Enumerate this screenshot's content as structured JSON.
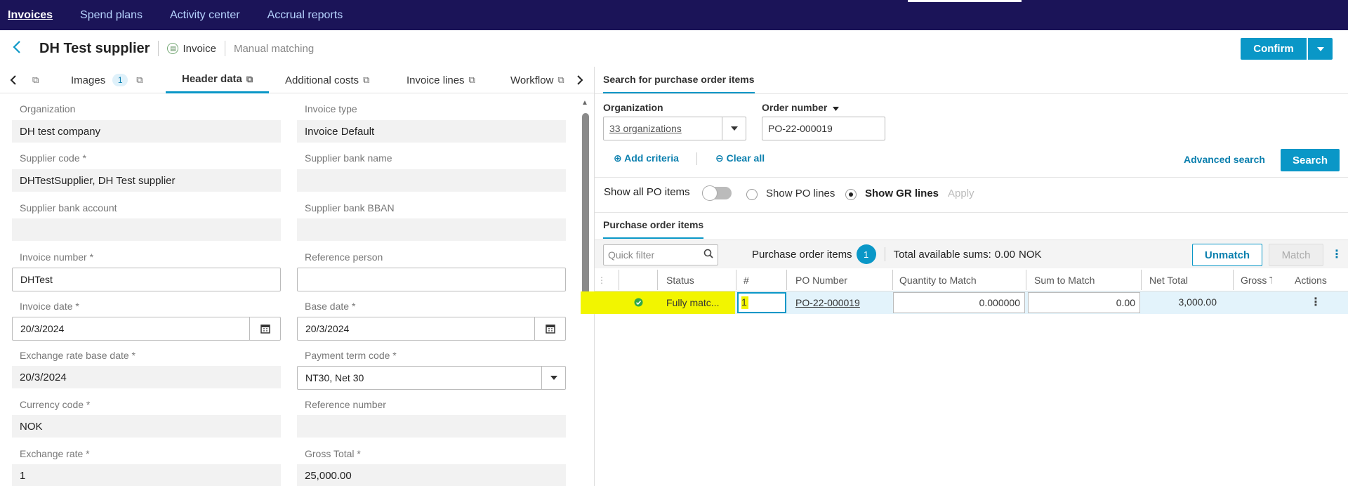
{
  "nav": {
    "items": [
      "Invoices",
      "Spend plans",
      "Activity center",
      "Accrual reports"
    ]
  },
  "header": {
    "back_icon": "chevron-left-icon",
    "title": "DH Test supplier",
    "doc_type": "Invoice",
    "mode": "Manual matching",
    "confirm_label": "Confirm"
  },
  "tabs": {
    "images": "Images",
    "images_count": "1",
    "header_data": "Header data",
    "additional_costs": "Additional costs",
    "invoice_lines": "Invoice lines",
    "workflow": "Workflow"
  },
  "form": {
    "organization_label": "Organization",
    "organization": "DH test company",
    "invoice_type_label": "Invoice type",
    "invoice_type": "Invoice Default",
    "supplier_code_label": "Supplier code *",
    "supplier_code": "DHTestSupplier, DH Test supplier",
    "supplier_bank_name_label": "Supplier bank name",
    "supplier_bank_name": "",
    "supplier_bank_account_label": "Supplier bank account",
    "supplier_bank_account": "",
    "supplier_bank_bban_label": "Supplier bank BBAN",
    "supplier_bank_bban": "",
    "invoice_number_label": "Invoice number *",
    "invoice_number": "DHTest",
    "reference_person_label": "Reference person",
    "reference_person": "",
    "invoice_date_label": "Invoice date *",
    "invoice_date": "20/3/2024",
    "base_date_label": "Base date *",
    "base_date": "20/3/2024",
    "exchange_rate_base_date_label": "Exchange rate base date *",
    "exchange_rate_base_date": "20/3/2024",
    "payment_term_code_label": "Payment term code *",
    "payment_term_code": "NT30, Net 30",
    "currency_code_label": "Currency code *",
    "currency_code": "NOK",
    "reference_number_label": "Reference number",
    "reference_number": "",
    "exchange_rate_label": "Exchange rate *",
    "exchange_rate": "1",
    "gross_total_label": "Gross Total *",
    "gross_total": "25,000.00"
  },
  "search": {
    "tab": "Search for purchase order items",
    "organization_label": "Organization",
    "organization_value": "33 organizations",
    "order_number_label": "Order number",
    "order_number_value": "PO-22-000019",
    "add_criteria": "Add criteria",
    "clear_all": "Clear all",
    "advanced_search": "Advanced search",
    "search_button": "Search",
    "show_all_po_items": "Show all PO items",
    "show_po_lines": "Show PO lines",
    "show_gr_lines": "Show GR lines",
    "apply": "Apply"
  },
  "po_items": {
    "tab": "Purchase order items",
    "quick_filter_placeholder": "Quick filter",
    "label": "Purchase order items",
    "count": "1",
    "total_label": "Total available sums:",
    "total_value": "0.00",
    "total_currency": "NOK",
    "unmatch": "Unmatch",
    "match": "Match",
    "columns": {
      "status": "Status",
      "num": "#",
      "po_number": "PO Number",
      "qty_to_match": "Quantity to Match",
      "sum_to_match": "Sum to Match",
      "net_total": "Net Total",
      "gross_total": "Gross To",
      "actions": "Actions"
    },
    "rows": [
      {
        "status": "Fully matc...",
        "num": "1",
        "po_number": "PO-22-000019",
        "qty_to_match": "0.000000",
        "sum_to_match": "0.00",
        "net_total": "3,000.00",
        "gross_total": ""
      }
    ]
  },
  "colors": {
    "nav_bg": "#1b1458",
    "accent": "#0a97c7",
    "highlight": "#f2f500"
  }
}
